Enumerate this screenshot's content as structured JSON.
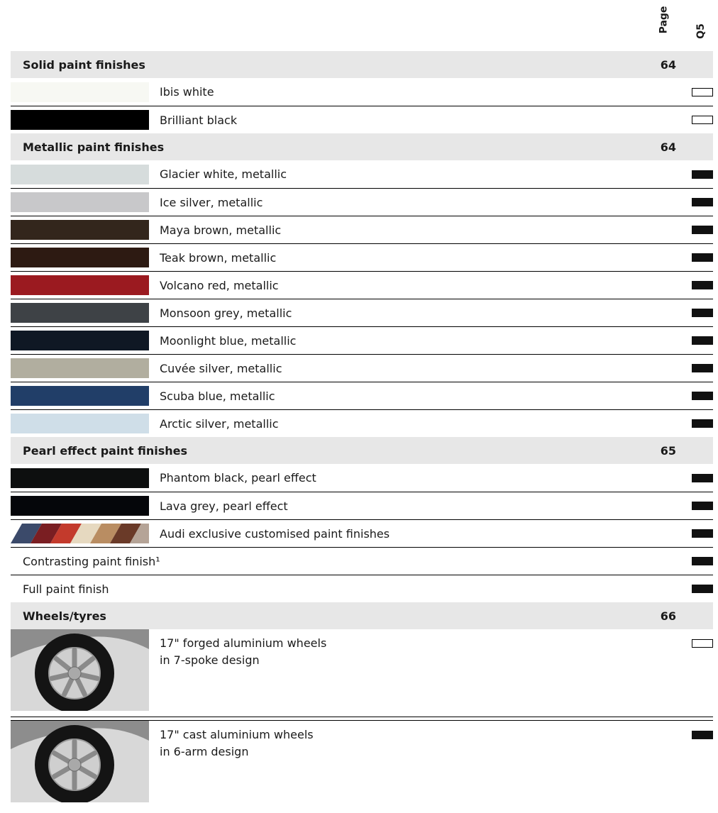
{
  "header": {
    "page_label": "Page",
    "model_label": "Q5"
  },
  "sections": [
    {
      "title": "Solid paint finishes",
      "page": "64",
      "rows": [
        {
          "label": "Ibis white",
          "swatch": "#f7f8f3",
          "availability": "standard"
        },
        {
          "label": "Brilliant black",
          "swatch": "#000000",
          "availability": "standard"
        }
      ]
    },
    {
      "title": "Metallic paint finishes",
      "page": "64",
      "rows": [
        {
          "label": "Glacier white, metallic",
          "swatch": "#d6dcdc",
          "availability": "optional"
        },
        {
          "label": "Ice silver, metallic",
          "swatch": "#c8c8ca",
          "availability": "optional"
        },
        {
          "label": "Maya brown, metallic",
          "swatch": "#33261c",
          "availability": "optional"
        },
        {
          "label": "Teak brown, metallic",
          "swatch": "#2d1a12",
          "availability": "optional"
        },
        {
          "label": "Volcano red, metallic",
          "swatch": "#9b1a20",
          "availability": "optional"
        },
        {
          "label": "Monsoon grey, metallic",
          "swatch": "#3e4246",
          "availability": "optional"
        },
        {
          "label": "Moonlight blue, metallic",
          "swatch": "#0f1824",
          "availability": "optional"
        },
        {
          "label": "Cuvée silver, metallic",
          "swatch": "#b1ae9f",
          "availability": "optional"
        },
        {
          "label": "Scuba blue, metallic",
          "swatch": "#213e68",
          "availability": "optional"
        },
        {
          "label": "Arctic silver, metallic",
          "swatch": "#cfdee8",
          "availability": "optional"
        }
      ]
    },
    {
      "title": "Pearl effect paint finishes",
      "page": "65",
      "rows": [
        {
          "label": "Phantom black, pearl effect",
          "swatch": "#0d0f0f",
          "availability": "optional"
        },
        {
          "label": "Lava grey, pearl effect",
          "swatch": "#05060a",
          "availability": "optional"
        },
        {
          "label": "Audi exclusive customised paint finishes",
          "swatch": "multicolor",
          "availability": "optional"
        },
        {
          "label": "Contrasting paint finish¹",
          "swatch": "none",
          "availability": "optional"
        },
        {
          "label": "Full paint finish",
          "swatch": "none",
          "availability": "optional"
        }
      ]
    },
    {
      "title": "Wheels/tyres",
      "page": "66",
      "wheels": [
        {
          "line1": "17\" forged aluminium wheels",
          "line2": "in 7-spoke design",
          "availability": "standard",
          "spokes": 7
        },
        {
          "line1": "17\" cast aluminium wheels",
          "line2": "in 6-arm design",
          "availability": "optional",
          "spokes": 6
        }
      ]
    }
  ]
}
